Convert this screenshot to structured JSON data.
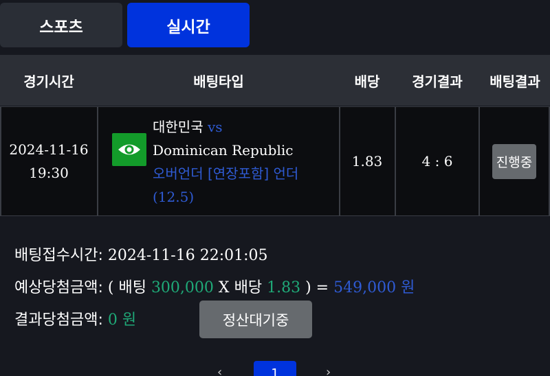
{
  "tabs": [
    {
      "label": "스포츠",
      "active": false
    },
    {
      "label": "실시간",
      "active": true
    }
  ],
  "table": {
    "headers": {
      "time": "경기시간",
      "bet_type": "배팅타입",
      "odds": "배당",
      "result": "경기결과",
      "bet_result": "배팅결과"
    },
    "row": {
      "date": "2024-11-16",
      "time": "19:30",
      "home": "대한민국",
      "vs": "vs",
      "away": "Dominican Republic",
      "market": "오버언더 [연장포함] 언더",
      "line": "(12.5)",
      "odds": "1.83",
      "score": "4 : 6",
      "status": "진행중"
    }
  },
  "info": {
    "accept_label": "배팅접수시간:",
    "accept_time": "2024-11-16 22:01:05",
    "expected_label": "예상당첨금액:",
    "paren_open": "(",
    "bet_word": "배팅",
    "bet_amount": "300,000",
    "times": "X",
    "odds_word": "배당",
    "odds_value": "1.83",
    "paren_close": ")",
    "equals": "=",
    "expected_amount": "549,000 원",
    "result_label": "결과당첨금액:",
    "result_amount": "0 원",
    "settle_button": "정산대기중"
  },
  "pagination": {
    "current": "1",
    "prev": "‹",
    "next": "›"
  },
  "colors": {
    "background": "#16181f",
    "active_tab": "#0033dd",
    "inactive_tab": "#2a2e36",
    "header_row": "#2c2f36",
    "highlight_green": "#1faa78",
    "highlight_blue": "#2f5bd4",
    "eye_icon_bg": "#139b2a",
    "gray_button": "#666a6e"
  }
}
